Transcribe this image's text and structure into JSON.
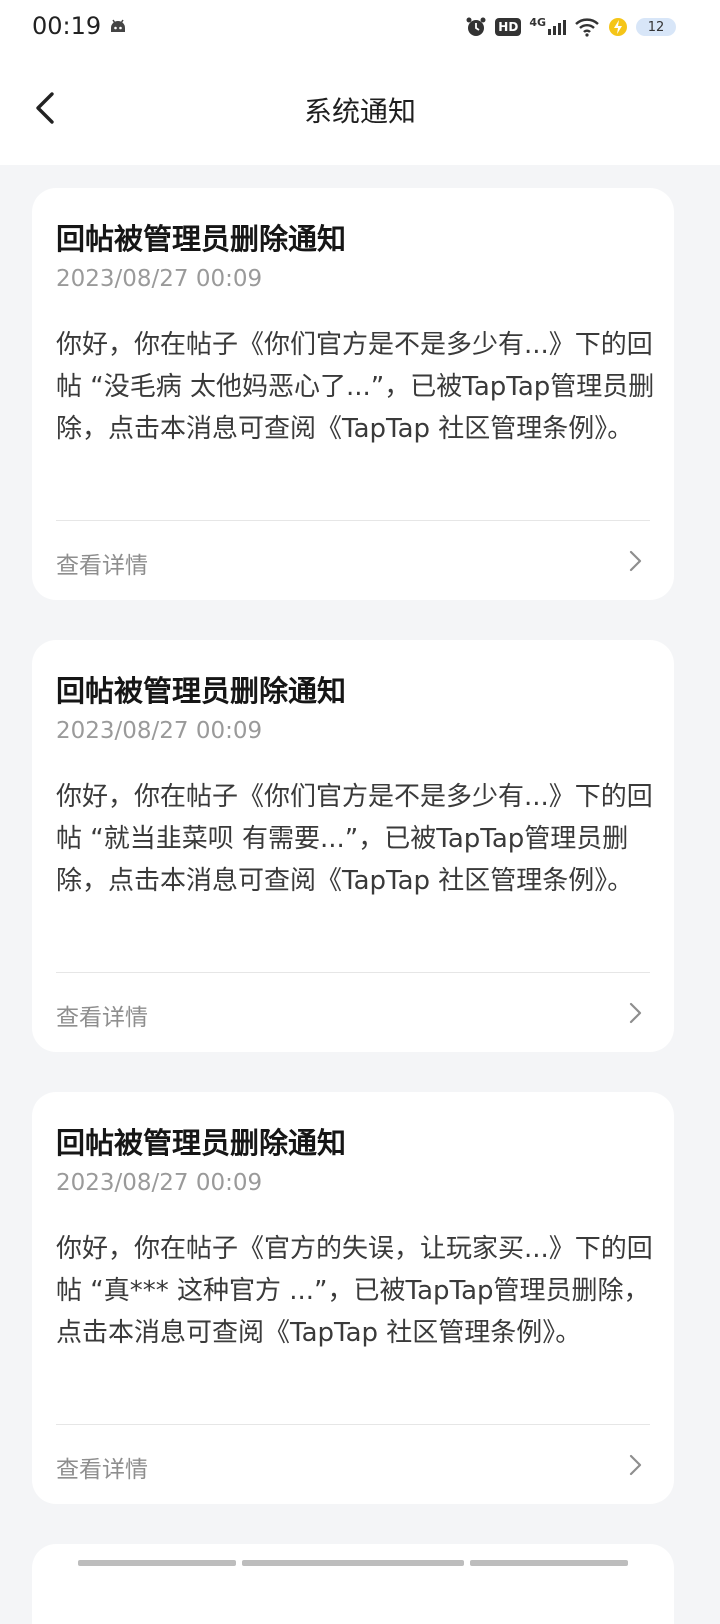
{
  "status_bar": {
    "time": "00:19",
    "hd": "HD",
    "network": "4G",
    "battery": "12"
  },
  "header": {
    "title": "系统通知"
  },
  "notifications": [
    {
      "title": "回帖被管理员删除通知",
      "time": "2023/08/27 00:09",
      "body": "你好，你在帖子《你们官方是不是多少有...》下的回帖 “没毛病 太他妈恶心了...”，已被TapTap管理员删除，点击本消息可查阅《TapTap 社区管理条例》。",
      "action": "查看详情"
    },
    {
      "title": "回帖被管理员删除通知",
      "time": "2023/08/27 00:09",
      "body": "你好，你在帖子《你们官方是不是多少有...》下的回帖 “就当韭菜呗  有需要...”，已被TapTap管理员删除，点击本消息可查阅《TapTap 社区管理条例》。",
      "action": "查看详情"
    },
    {
      "title": "回帖被管理员删除通知",
      "time": "2023/08/27 00:09",
      "body": "你好，你在帖子《官方的失误，让玩家买...》下的回帖 “真*** 这种官方 ...”，已被TapTap管理员删除，点击本消息可查阅《TapTap 社区管理条例》。",
      "action": "查看详情"
    }
  ],
  "colors": {
    "background": "#f4f5f7",
    "card": "#ffffff",
    "secondary_text": "#9a9a9a"
  }
}
